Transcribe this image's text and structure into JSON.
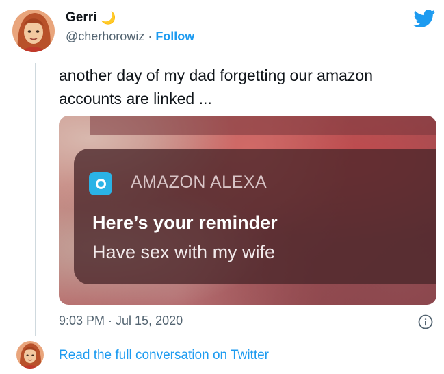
{
  "author": {
    "display_name": "Gerri",
    "name_emoji": "🌙",
    "handle": "@cherhorowiz",
    "separator": "·",
    "follow_label": "Follow"
  },
  "tweet": {
    "text": "another day of my dad forgetting our amazon accounts are linked ..."
  },
  "media": {
    "notification": {
      "app_name": "AMAZON ALEXA",
      "title": "Here’s your reminder",
      "body": "Have sex with my wife"
    }
  },
  "footer": {
    "timestamp": "9:03 PM · Jul 15, 2020",
    "read_link": "Read the full conversation on Twitter"
  },
  "icons": {
    "brand": "twitter-bird-icon",
    "info": "info-icon",
    "app": "alexa-app-icon",
    "moon": "crescent-moon-icon"
  },
  "colors": {
    "link": "#1d9bf0",
    "muted": "#536471",
    "alexa": "#2ab3e6"
  }
}
